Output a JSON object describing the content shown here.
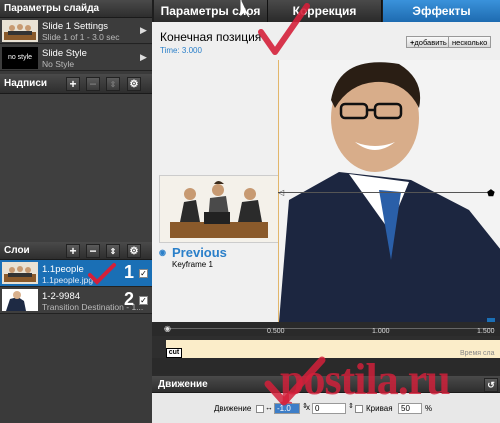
{
  "left": {
    "slide_params_title": "Параметры слайда",
    "slides": [
      {
        "title": "Slide 1 Settings",
        "sub": "Slide 1 of 1 - 3.0 sec"
      },
      {
        "title": "Slide Style",
        "sub": "No Style",
        "thumb_text": "no style"
      }
    ],
    "captions_title": "Надписи",
    "layers_title": "Слои",
    "layers": [
      {
        "title": "1.1people",
        "sub": "1.1people.jpg",
        "num": "1"
      },
      {
        "title": "1-2-9984",
        "sub": "Transition Destination - 1...",
        "num": "2"
      }
    ],
    "btn_add": "+",
    "btn_remove": "−"
  },
  "tabs": [
    "Параметры слоя",
    "Коррекция",
    "Эффекты"
  ],
  "props": {
    "title": "Конечная позиция",
    "time": "Time: 3.000",
    "add_label": "добавить",
    "several_label": "несколько"
  },
  "stage": {
    "prev_title": "Previous",
    "prev_sub": "Keyframe 1"
  },
  "timeline": {
    "ticks": [
      "0.500",
      "1.000",
      "1.500"
    ],
    "cut_label": "cut",
    "time_label": "Время сла"
  },
  "motion": {
    "title": "Движение",
    "label": "Движение",
    "x_value": "-1.0",
    "x_sep": "x",
    "y_value": "0",
    "curve_label": "Кривая",
    "curve_value": "50",
    "pct": "%"
  },
  "watermark": "postila.ru",
  "colors": {
    "accent_blue": "#1a6fb5",
    "active_tab": "#2a7fc9",
    "check_red": "#d4203a",
    "timeline_bar": "#fbedc9"
  }
}
